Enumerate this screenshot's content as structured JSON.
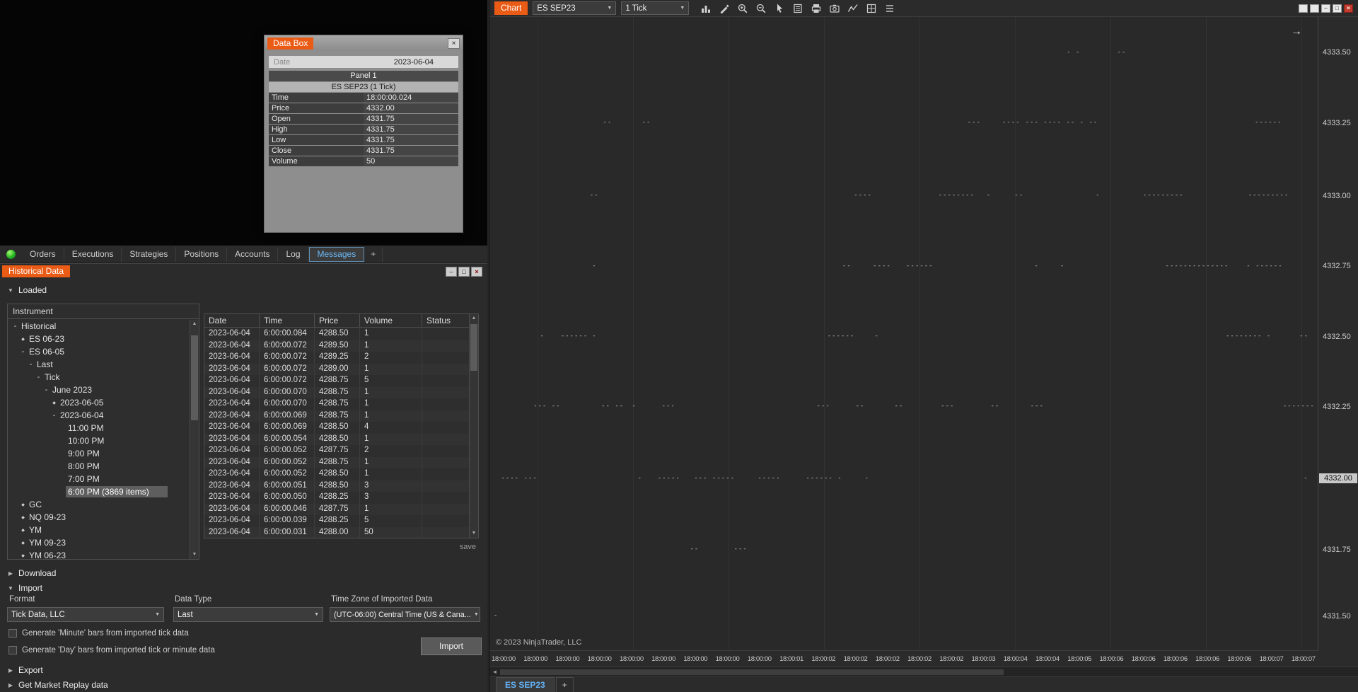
{
  "colors": {
    "accent_orange": "#ea5b16",
    "active_tab_blue": "#63b3f8",
    "price_marker_bg": "#c9c9c9",
    "status_green": "#1fae1f"
  },
  "icons": {
    "select_arrow": "▼",
    "up_arrow": "▲",
    "down_arrow": "▼",
    "left_arrow": "◄",
    "tree_collapsed": "◆",
    "tree_expanded": "-"
  },
  "data_box": {
    "title": "Data Box",
    "close_glyph": "×",
    "date_label": "Date",
    "date_value": "2023-06-04",
    "panel_label": "Panel 1",
    "series_label": "ES SEP23 (1 Tick)",
    "rows": [
      {
        "label": "Time",
        "value": "18:00:00.024"
      },
      {
        "label": "Price",
        "value": "4332.00"
      },
      {
        "label": "Open",
        "value": "4331.75"
      },
      {
        "label": "High",
        "value": "4331.75"
      },
      {
        "label": "Low",
        "value": "4331.75"
      },
      {
        "label": "Close",
        "value": "4331.75"
      },
      {
        "label": "Volume",
        "value": "50"
      }
    ]
  },
  "control_tabs": {
    "items": [
      "Orders",
      "Executions",
      "Strategies",
      "Positions",
      "Accounts",
      "Log",
      "Messages"
    ],
    "active": "Messages",
    "add_label": "+"
  },
  "historical": {
    "title": "Historical Data",
    "window_buttons": {
      "minimize": "–",
      "maximize": "□",
      "close": "×"
    },
    "sections": {
      "loaded": {
        "label": "Loaded",
        "arrow": "▼"
      },
      "download": {
        "label": "Download",
        "arrow": "▶"
      },
      "import": {
        "label": "Import",
        "arrow": "▼"
      },
      "export": {
        "label": "Export",
        "arrow": "▶"
      },
      "replay": {
        "label": "Get Market Replay data",
        "arrow": "▶"
      }
    },
    "tree": {
      "header": "Instrument",
      "items": [
        {
          "label": "Historical",
          "level": 0,
          "state": "expanded"
        },
        {
          "label": "ES 06-23",
          "level": 1,
          "state": "collapsed"
        },
        {
          "label": "ES 06-05",
          "level": 1,
          "state": "expanded"
        },
        {
          "label": "Last",
          "level": 2,
          "state": "expanded"
        },
        {
          "label": "Tick",
          "level": 3,
          "state": "expanded"
        },
        {
          "label": "June 2023",
          "level": 4,
          "state": "expanded"
        },
        {
          "label": "2023-06-05",
          "level": 5,
          "state": "collapsed"
        },
        {
          "label": "2023-06-04",
          "level": 5,
          "state": "expanded"
        },
        {
          "label": "11:00 PM",
          "level": 6,
          "state": "none"
        },
        {
          "label": "10:00 PM",
          "level": 6,
          "state": "none"
        },
        {
          "label": "9:00 PM",
          "level": 6,
          "state": "none"
        },
        {
          "label": "8:00 PM",
          "level": 6,
          "state": "none"
        },
        {
          "label": "7:00 PM",
          "level": 6,
          "state": "none"
        },
        {
          "label": "6:00 PM (3869 items)",
          "level": 6,
          "state": "none",
          "selected": true
        },
        {
          "label": "GC",
          "level": 1,
          "state": "collapsed"
        },
        {
          "label": "NQ 09-23",
          "level": 1,
          "state": "collapsed"
        },
        {
          "label": "YM",
          "level": 1,
          "state": "collapsed"
        },
        {
          "label": "YM 09-23",
          "level": 1,
          "state": "collapsed"
        },
        {
          "label": "YM 06-23",
          "level": 1,
          "state": "collapsed"
        }
      ]
    },
    "table": {
      "columns": [
        "Date",
        "Time",
        "Price",
        "Volume",
        "Status"
      ],
      "rows": [
        [
          "2023-06-04",
          "6:00:00.084",
          "4288.50",
          "1",
          ""
        ],
        [
          "2023-06-04",
          "6:00:00.072",
          "4289.50",
          "1",
          ""
        ],
        [
          "2023-06-04",
          "6:00:00.072",
          "4289.25",
          "2",
          ""
        ],
        [
          "2023-06-04",
          "6:00:00.072",
          "4289.00",
          "1",
          ""
        ],
        [
          "2023-06-04",
          "6:00:00.072",
          "4288.75",
          "5",
          ""
        ],
        [
          "2023-06-04",
          "6:00:00.070",
          "4288.75",
          "1",
          ""
        ],
        [
          "2023-06-04",
          "6:00:00.070",
          "4288.75",
          "1",
          ""
        ],
        [
          "2023-06-04",
          "6:00:00.069",
          "4288.75",
          "1",
          ""
        ],
        [
          "2023-06-04",
          "6:00:00.069",
          "4288.50",
          "4",
          ""
        ],
        [
          "2023-06-04",
          "6:00:00.054",
          "4288.50",
          "1",
          ""
        ],
        [
          "2023-06-04",
          "6:00:00.052",
          "4287.75",
          "2",
          ""
        ],
        [
          "2023-06-04",
          "6:00:00.052",
          "4288.75",
          "1",
          ""
        ],
        [
          "2023-06-04",
          "6:00:00.052",
          "4288.50",
          "1",
          ""
        ],
        [
          "2023-06-04",
          "6:00:00.051",
          "4288.50",
          "3",
          ""
        ],
        [
          "2023-06-04",
          "6:00:00.050",
          "4288.25",
          "3",
          ""
        ],
        [
          "2023-06-04",
          "6:00:00.046",
          "4287.75",
          "1",
          ""
        ],
        [
          "2023-06-04",
          "6:00:00.039",
          "4288.25",
          "5",
          ""
        ],
        [
          "2023-06-04",
          "6:00:00.031",
          "4288.00",
          "50",
          ""
        ]
      ]
    },
    "save_label": "save",
    "import_form": {
      "format_label": "Format",
      "format_value": "Tick Data, LLC",
      "datatype_label": "Data Type",
      "datatype_value": "Last",
      "timezone_label": "Time Zone of Imported Data",
      "timezone_value": "(UTC-06:00) Central Time (US & Cana...",
      "checkbox_minute": "Generate 'Minute' bars from imported tick data",
      "checkbox_day": "Generate 'Day' bars from imported tick or minute data",
      "import_button": "Import"
    }
  },
  "chart": {
    "chip": "Chart",
    "instrument": "ES SEP23",
    "interval": "1 Tick",
    "toolbar_icons": [
      "chart-style",
      "drawing-tools",
      "zoom-in",
      "zoom-out",
      "cursor",
      "data-box",
      "print",
      "snapshot",
      "indicators",
      "chart-trader",
      "properties"
    ],
    "window_buttons": {
      "minimize": "–",
      "maximize": "□",
      "close": "×"
    },
    "scroll_arrow": "→",
    "copyright": "© 2023 NinjaTrader, LLC",
    "tabs": [
      {
        "label": "ES SEP23",
        "active": true
      }
    ],
    "add_tab_label": "+"
  },
  "chart_data": {
    "type": "scatter",
    "title": "ES SEP23 1 Tick",
    "ylabel": "Price",
    "ylim": [
      4331.5,
      4333.5
    ],
    "grid": "vertical-faint",
    "legend": "none",
    "price_levels": [
      {
        "value": "4333.50",
        "pct": 5.6
      },
      {
        "value": "4333.25",
        "pct": 16.7
      },
      {
        "value": "4333.00",
        "pct": 28.2
      },
      {
        "value": "4332.75",
        "pct": 39.3
      },
      {
        "value": "4332.50",
        "pct": 50.4
      },
      {
        "value": "4332.25",
        "pct": 61.5
      },
      {
        "value": "4332.00",
        "pct": 72.8,
        "marker": true
      },
      {
        "value": "4331.75",
        "pct": 84.0
      },
      {
        "value": "4331.50",
        "pct": 94.5
      }
    ],
    "time_labels": [
      "18:00:00",
      "18:00:00",
      "18:00:00",
      "18:00:00",
      "18:00:00",
      "18:00:00",
      "18:00:00",
      "18:00:00",
      "18:00:00",
      "18:00:01",
      "18:00:02",
      "18:00:02",
      "18:00:02",
      "18:00:02",
      "18:00:02",
      "18:00:03",
      "18:00:04",
      "18:00:04",
      "18:00:05",
      "18:00:06",
      "18:00:06",
      "18:00:06",
      "18:00:06",
      "18:00:06",
      "18:00:07",
      "18:00:07"
    ],
    "marks": [
      {
        "r": 0,
        "x": 69.7,
        "p": "- -"
      },
      {
        "r": 0,
        "x": 75.8,
        "p": "--"
      },
      {
        "r": 1,
        "x": 13.7,
        "p": "--"
      },
      {
        "r": 1,
        "x": 18.4,
        "p": "--"
      },
      {
        "r": 1,
        "x": 57.7,
        "p": "---"
      },
      {
        "r": 1,
        "x": 61.9,
        "p": "----"
      },
      {
        "r": 1,
        "x": 64.7,
        "p": "--- ---- -- - --"
      },
      {
        "r": 1,
        "x": 92.4,
        "p": "------"
      },
      {
        "r": 2,
        "x": 12.1,
        "p": "--"
      },
      {
        "r": 2,
        "x": 44.0,
        "p": "----"
      },
      {
        "r": 2,
        "x": 54.2,
        "p": "--------"
      },
      {
        "r": 2,
        "x": 60.0,
        "p": "-"
      },
      {
        "r": 2,
        "x": 63.4,
        "p": "--"
      },
      {
        "r": 2,
        "x": 73.2,
        "p": "-"
      },
      {
        "r": 2,
        "x": 78.9,
        "p": "---------"
      },
      {
        "r": 2,
        "x": 91.6,
        "p": "---------"
      },
      {
        "r": 3,
        "x": 12.4,
        "p": "-"
      },
      {
        "r": 3,
        "x": 42.6,
        "p": "--"
      },
      {
        "r": 3,
        "x": 46.3,
        "p": "----"
      },
      {
        "r": 3,
        "x": 50.3,
        "p": "------"
      },
      {
        "r": 3,
        "x": 65.8,
        "p": "-"
      },
      {
        "r": 3,
        "x": 68.9,
        "p": "-"
      },
      {
        "r": 3,
        "x": 81.6,
        "p": "--------------"
      },
      {
        "r": 3,
        "x": 91.4,
        "p": "- ------"
      },
      {
        "r": 4,
        "x": 6.1,
        "p": "-"
      },
      {
        "r": 4,
        "x": 8.6,
        "p": "------"
      },
      {
        "r": 4,
        "x": 12.4,
        "p": "-"
      },
      {
        "r": 4,
        "x": 40.8,
        "p": "------"
      },
      {
        "r": 4,
        "x": 46.5,
        "p": "-"
      },
      {
        "r": 4,
        "x": 88.9,
        "p": "-------- -"
      },
      {
        "r": 4,
        "x": 97.8,
        "p": "--"
      },
      {
        "r": 5,
        "x": 5.3,
        "p": "--- --"
      },
      {
        "r": 5,
        "x": 13.5,
        "p": "-- --"
      },
      {
        "r": 5,
        "x": 17.2,
        "p": "-"
      },
      {
        "r": 5,
        "x": 20.8,
        "p": "---"
      },
      {
        "r": 5,
        "x": 39.5,
        "p": "---"
      },
      {
        "r": 5,
        "x": 44.2,
        "p": "--"
      },
      {
        "r": 5,
        "x": 48.9,
        "p": "--"
      },
      {
        "r": 5,
        "x": 54.5,
        "p": "---"
      },
      {
        "r": 5,
        "x": 60.5,
        "p": "--"
      },
      {
        "r": 5,
        "x": 65.3,
        "p": "---"
      },
      {
        "r": 5,
        "x": 95.8,
        "p": "-------"
      },
      {
        "r": 6,
        "x": 1.4,
        "p": "---- ---"
      },
      {
        "r": 6,
        "x": 17.9,
        "p": "-"
      },
      {
        "r": 6,
        "x": 20.3,
        "p": "-----"
      },
      {
        "r": 6,
        "x": 24.7,
        "p": "--- -----"
      },
      {
        "r": 6,
        "x": 32.4,
        "p": "-----"
      },
      {
        "r": 6,
        "x": 38.2,
        "p": "------ -"
      },
      {
        "r": 6,
        "x": 45.3,
        "p": "-"
      },
      {
        "r": 6,
        "x": 98.3,
        "p": "-"
      },
      {
        "r": 7,
        "x": 24.2,
        "p": "--"
      },
      {
        "r": 7,
        "x": 29.5,
        "p": "---"
      },
      {
        "r": 8,
        "x": 0.5,
        "p": "-"
      }
    ]
  }
}
